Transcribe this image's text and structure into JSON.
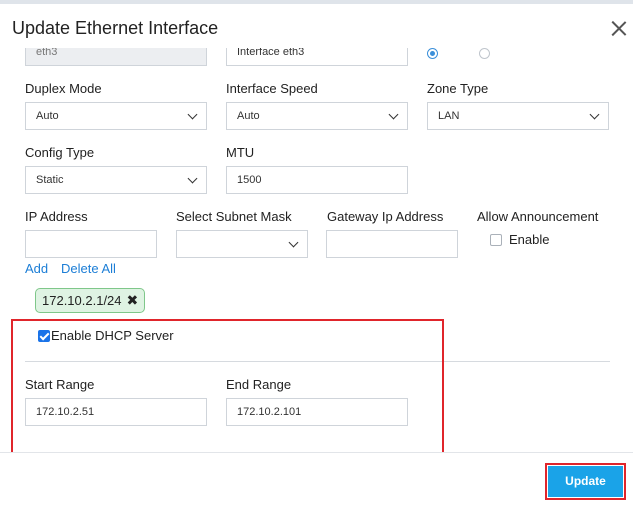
{
  "dialog": {
    "title": "Update Ethernet Interface"
  },
  "partial_row": {
    "interface_name_value": "eth3",
    "description_value": "Interface eth3"
  },
  "fields": {
    "duplex_mode": {
      "label": "Duplex Mode",
      "value": "Auto"
    },
    "interface_speed": {
      "label": "Interface Speed",
      "value": "Auto"
    },
    "zone_type": {
      "label": "Zone Type",
      "value": "LAN"
    },
    "config_type": {
      "label": "Config Type",
      "value": "Static"
    },
    "mtu": {
      "label": "MTU",
      "value": "1500"
    },
    "ip_address": {
      "label": "IP Address",
      "value": ""
    },
    "subnet_mask": {
      "label": "Select Subnet Mask",
      "value": ""
    },
    "gateway_ip": {
      "label": "Gateway Ip Address",
      "value": ""
    },
    "allow_announcement": {
      "label": "Allow Announcement",
      "option_label": "Enable",
      "checked": false
    }
  },
  "actions": {
    "add_label": "Add",
    "delete_all_label": "Delete All"
  },
  "ip_tags": [
    {
      "value": "172.10.2.1/24"
    }
  ],
  "dhcp": {
    "enable_label": "Enable DHCP Server",
    "enabled": true,
    "start_range": {
      "label": "Start Range",
      "value": "172.10.2.51"
    },
    "end_range": {
      "label": "End Range",
      "value": "172.10.2.101"
    }
  },
  "footer": {
    "update_label": "Update"
  },
  "colors": {
    "primary_button": "#1aa3e8",
    "highlight_border": "#e0252b",
    "link": "#1c7ed6",
    "tag_background": "#dff3e3",
    "tag_border": "#7fc78a",
    "checkbox_checked": "#1a73e8"
  }
}
